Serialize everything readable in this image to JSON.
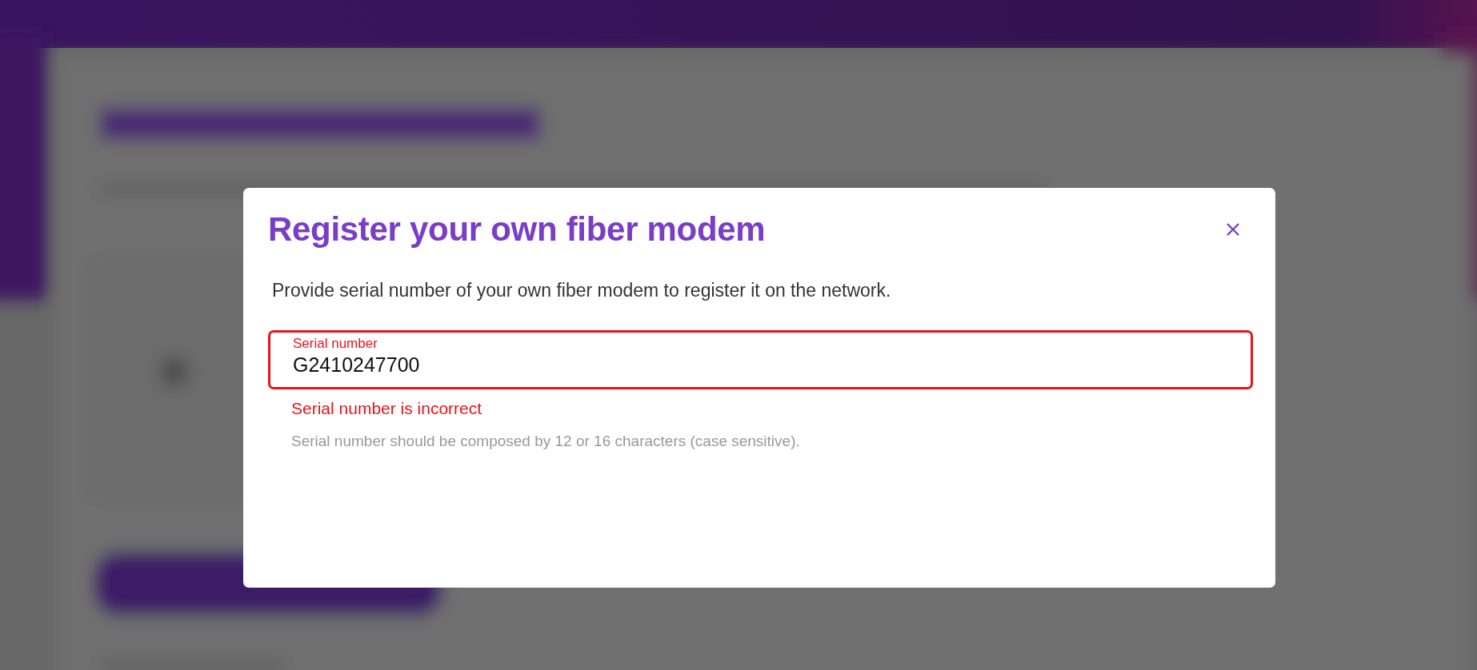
{
  "dialog": {
    "title": "Register your own fiber modem",
    "description": "Provide serial number of your own fiber modem to register it on the network.",
    "field": {
      "label": "Serial number",
      "value": "G2410247700",
      "invalid": true
    },
    "error": "Serial number is incorrect",
    "hint": "Serial number should be composed by 12 or 16 characters (case sensitive)."
  }
}
